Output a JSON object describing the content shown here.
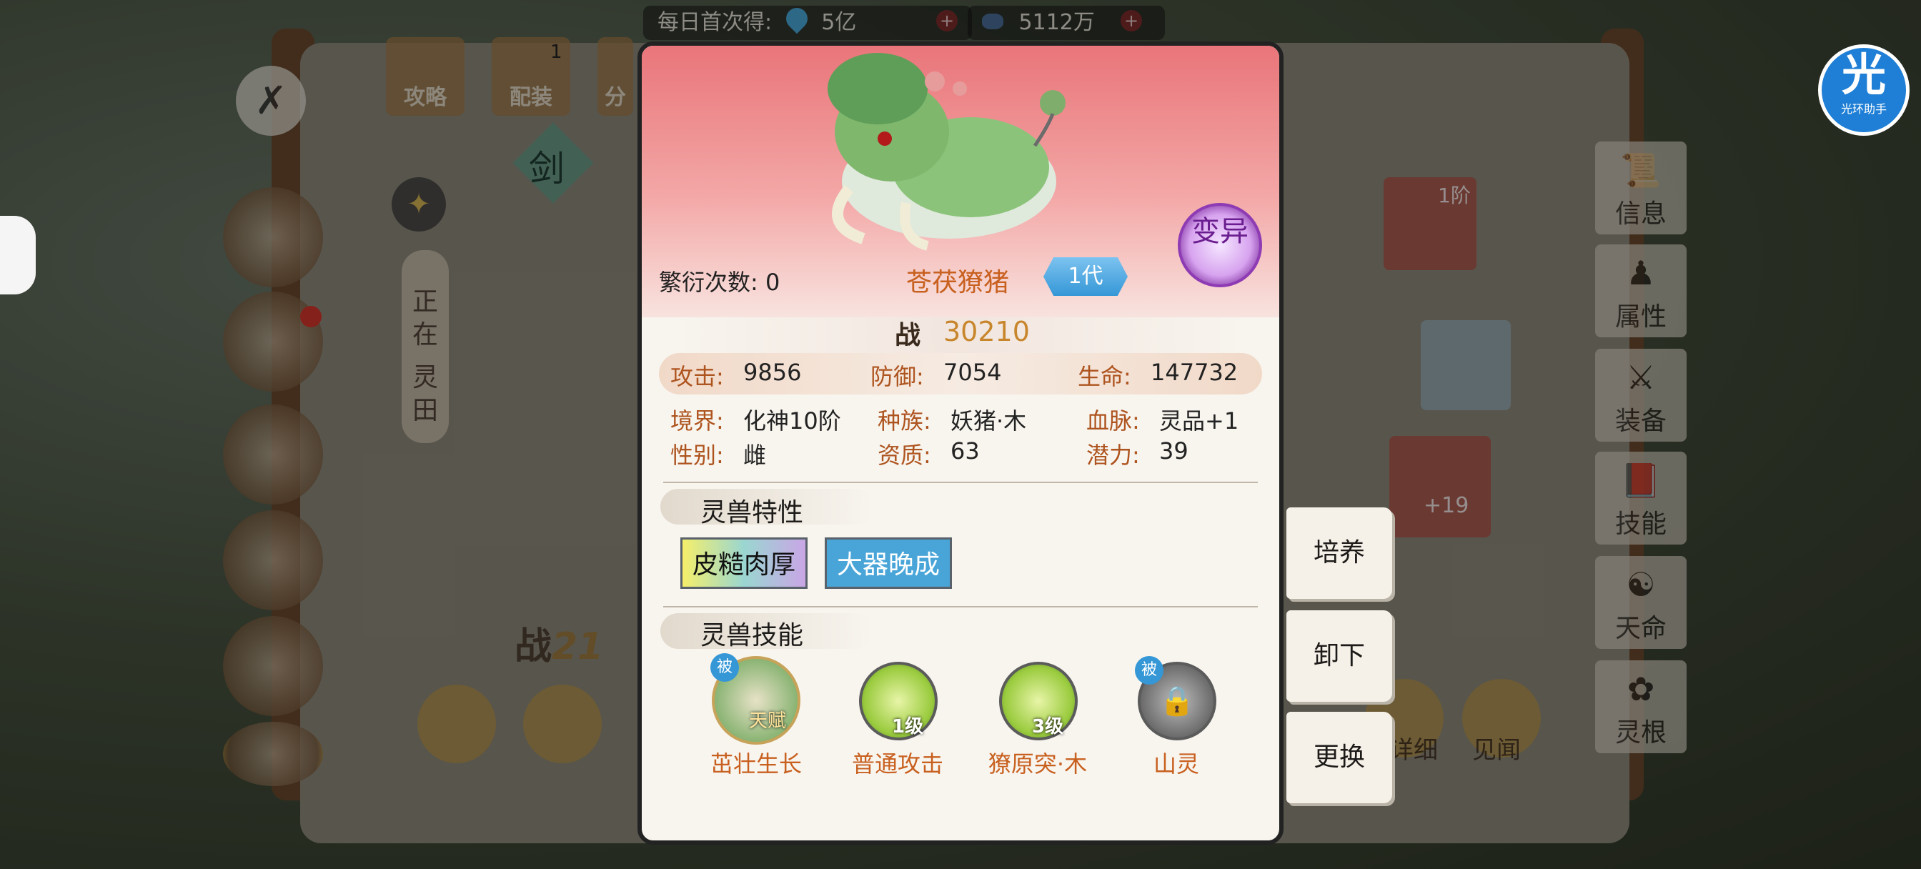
{
  "top_bar": {
    "daily_first_label": "每日首次得:",
    "daily_amount": "5亿",
    "spirit_stones": "5112万"
  },
  "left_tabs": [
    "攻略",
    "配装",
    "分"
  ],
  "left_tab_badge": "1",
  "left_panel": {
    "sword_label": "剑",
    "status_vertical": [
      "正",
      "在",
      "灵",
      "田"
    ],
    "battle_prefix": "战",
    "battle_partial": "21"
  },
  "right_tabs": [
    {
      "icon": "scroll-icon",
      "label": "信息"
    },
    {
      "icon": "body-icon",
      "label": "属性"
    },
    {
      "icon": "armor-icon",
      "label": "装备"
    },
    {
      "icon": "book-icon",
      "label": "技能"
    },
    {
      "icon": "fate-icon",
      "label": "天命"
    },
    {
      "icon": "root-icon",
      "label": "灵根"
    }
  ],
  "right_panel": {
    "rank_label": "1阶",
    "plus_label": "+19",
    "bottom_items": [
      "详细",
      "见闻"
    ]
  },
  "actions": {
    "train": "培养",
    "unequip": "卸下",
    "replace": "更换"
  },
  "helper_logo": {
    "glyph": "光",
    "name": "光环助手"
  },
  "beast": {
    "breed_label": "繁衍次数:",
    "breed_count": "0",
    "name": "苍茯獠猪",
    "generation": "1代",
    "mutation": "变异",
    "power_icon": "战",
    "power": "30210",
    "stats": {
      "attack_label": "攻击:",
      "attack": "9856",
      "defense_label": "防御:",
      "defense": "7054",
      "hp_label": "生命:",
      "hp": "147732"
    },
    "info": {
      "realm_label": "境界:",
      "realm": "化神10阶",
      "race_label": "种族:",
      "race": "妖猪·木",
      "bloodline_label": "血脉:",
      "bloodline": "灵品+1",
      "gender_label": "性别:",
      "gender": "雌",
      "aptitude_label": "资质:",
      "aptitude": "63",
      "potential_label": "潜力:",
      "potential": "39"
    },
    "traits_title": "灵兽特性",
    "traits": [
      "皮糙肉厚",
      "大器晚成"
    ],
    "skills_title": "灵兽技能",
    "skills": [
      {
        "name": "茁壮生长",
        "badge": "被",
        "tag": "天赋"
      },
      {
        "name": "普通攻击",
        "level": "1级"
      },
      {
        "name": "獠原突·木",
        "level": "3级"
      },
      {
        "name": "山灵",
        "badge": "被"
      }
    ]
  },
  "colors": {
    "accent_orange": "#c8601f",
    "label_brown": "#ae541f",
    "banner_pink": "#e9757a",
    "generation_blue": "#3597d6",
    "mutation_purple": "#8e3bb4"
  }
}
